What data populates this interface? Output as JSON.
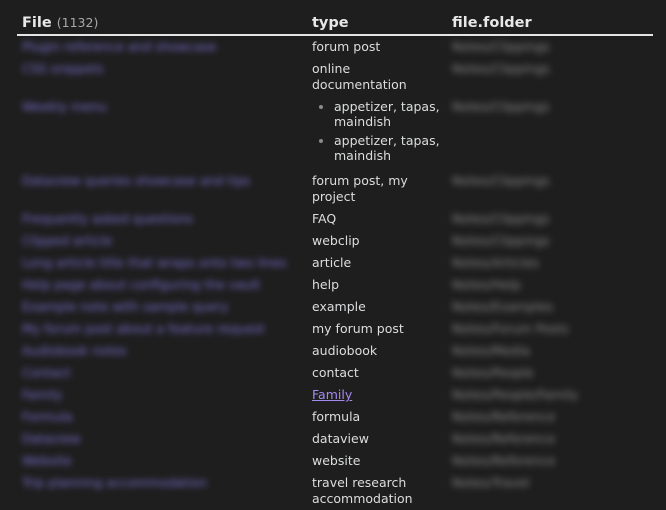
{
  "table": {
    "headers": {
      "file": "File",
      "count": "(1132)",
      "type": "type",
      "folder": "file.folder"
    },
    "rows": [
      {
        "file": "Plugin reference and showcase",
        "type": "forum post",
        "folder": "Notes/Clippings"
      },
      {
        "file": "CSS snippets",
        "type": "online documentation",
        "folder": "Notes/Clippings"
      },
      {
        "file": "Weekly menu",
        "type_list": [
          "appetizer, tapas, maindish",
          "appetizer, tapas, maindish"
        ],
        "folder": "Notes/Clippings"
      },
      {
        "file": "Dataview queries showcase and tips",
        "type": "forum post, my project",
        "folder": "Notes/Clippings"
      },
      {
        "file": "Frequently asked questions",
        "type": "FAQ",
        "folder": "Notes/Clippings"
      },
      {
        "file": "Clipped article",
        "type": "webclip",
        "folder": "Notes/Clippings"
      },
      {
        "file": "Long article title that wraps onto two lines",
        "type": "article",
        "folder": "Notes/Articles"
      },
      {
        "file": "Help page about configuring the vault",
        "type": "help",
        "folder": "Notes/Help"
      },
      {
        "file": "Example note with sample query",
        "type": "example",
        "folder": "Notes/Examples"
      },
      {
        "file": "My forum post about a feature request",
        "type": "my forum post",
        "folder": "Notes/Forum Posts"
      },
      {
        "file": "Audiobook notes",
        "type": "audiobook",
        "folder": "Notes/Media"
      },
      {
        "file": "Contact",
        "type": "contact",
        "folder": "Notes/People"
      },
      {
        "file": "Family",
        "type_link": "Family",
        "folder": "Notes/People/Family"
      },
      {
        "file": "Formula",
        "type": "formula",
        "folder": "Notes/Reference"
      },
      {
        "file": "Dataview",
        "type": "dataview",
        "folder": "Notes/Reference"
      },
      {
        "file": "Website",
        "type": "website",
        "folder": "Notes/Reference"
      },
      {
        "file": "Trip planning accommodation",
        "type": "travel research accommodation",
        "folder": "Notes/Travel"
      }
    ]
  }
}
